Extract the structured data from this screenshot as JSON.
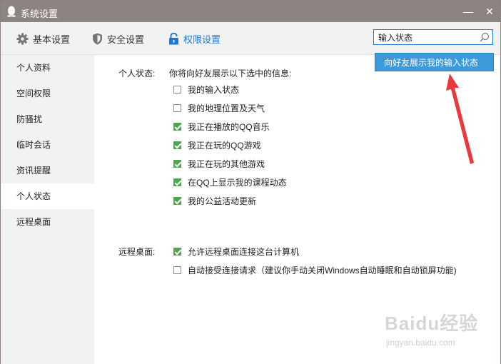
{
  "window": {
    "title": "系统设置",
    "minimize": "—",
    "close": "✕"
  },
  "tabs": [
    {
      "label": "基本设置",
      "icon": "gear-icon"
    },
    {
      "label": "安全设置",
      "icon": "shield-icon"
    },
    {
      "label": "权限设置",
      "icon": "lock-icon",
      "active": true
    }
  ],
  "search": {
    "value": "输入状态",
    "suggestion": "向好友展示我的输入状态"
  },
  "sidebar": {
    "items": [
      {
        "label": "个人资料"
      },
      {
        "label": "空间权限"
      },
      {
        "label": "防骚扰"
      },
      {
        "label": "临时会话"
      },
      {
        "label": "资讯提醒"
      },
      {
        "label": "个人状态",
        "active": true
      },
      {
        "label": "远程桌面"
      }
    ]
  },
  "personal_status": {
    "label": "个人状态:",
    "desc": "你将向好友展示以下选中的信息:",
    "options": [
      {
        "label": "我的输入状态",
        "checked": false
      },
      {
        "label": "我的地理位置及天气",
        "checked": false
      },
      {
        "label": "我正在播放的QQ音乐",
        "checked": true
      },
      {
        "label": "我正在玩的QQ游戏",
        "checked": true
      },
      {
        "label": "我正在玩的其他游戏",
        "checked": true
      },
      {
        "label": "在QQ上显示我的课程动态",
        "checked": true
      },
      {
        "label": "我的公益活动更新",
        "checked": true
      }
    ]
  },
  "remote_desktop": {
    "label": "远程桌面:",
    "options": [
      {
        "label": "允许远程桌面连接这台计算机",
        "checked": true
      },
      {
        "label": "自动接受连接请求（建议你手动关闭Windows自动睡眠和自动锁屏功能)",
        "checked": false
      }
    ]
  },
  "watermark": {
    "line1": "Baidu经验",
    "line2": "jingyan.baidu.com"
  },
  "colors": {
    "accent": "#1a7bd6",
    "titlebar": "#8e8383",
    "check": "#4fa64f",
    "suggest": "#3c9ad8",
    "arrow": "#e8393c"
  }
}
